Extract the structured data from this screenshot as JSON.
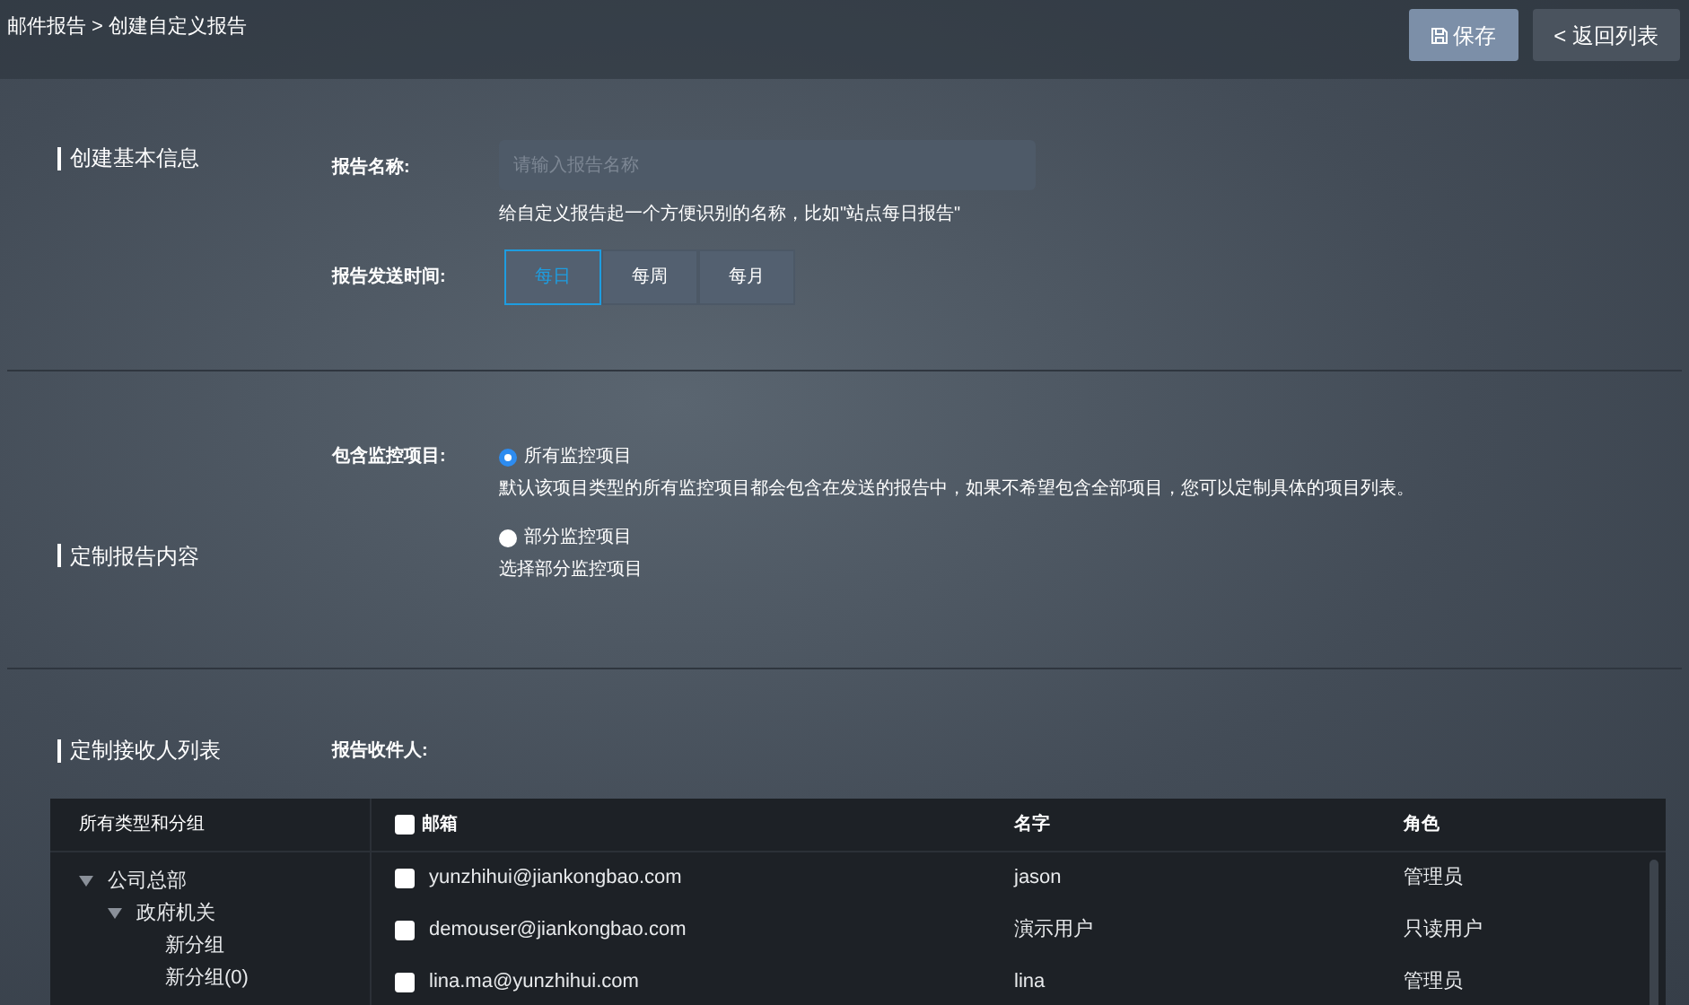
{
  "breadcrumb": "邮件报告 > 创建自定义报告",
  "header_buttons": [
    {
      "kind": "save",
      "label": "保存"
    },
    {
      "kind": "back",
      "label": "< 返回列表"
    }
  ],
  "basic_info": {
    "heading": "创建基本信息",
    "name_label": "报告名称:",
    "name_placeholder": "请输入报告名称",
    "name_help": "给自定义报告起一个方便识别的名称，比如\"站点每日报告\"",
    "time_label": "报告发送时间:",
    "time_options": [
      {
        "label": "每日",
        "selected": true
      },
      {
        "label": "每周",
        "selected": false
      },
      {
        "label": "每月",
        "selected": false
      }
    ]
  },
  "content": {
    "heading": "定制报告内容",
    "label": "包含监控项目:",
    "options": [
      {
        "label": "所有监控项目",
        "description": "默认该项目类型的所有监控项目都会包含在发送的报告中，如果不希望包含全部项目，您可以定制具体的项目列表。",
        "selected": true
      },
      {
        "label": "部分监控项目",
        "description": "选择部分监控项目",
        "selected": false
      }
    ]
  },
  "recipients": {
    "heading": "定制接收人列表",
    "label": "报告收件人:",
    "tree_heading": "所有类型和分组",
    "tree": [
      {
        "label": "公司总部",
        "expanded": true,
        "children": [
          {
            "label": "政府机关",
            "expanded": true,
            "children": [
              {
                "label": "新分组"
              },
              {
                "label": "新分组(0)"
              }
            ]
          }
        ]
      }
    ],
    "table": {
      "columns": [
        "邮箱",
        "名字",
        "角色"
      ],
      "all_checked": false,
      "rows": [
        {
          "email": "yunzhihui@jiankongbao.com",
          "name": "jason",
          "role": "管理员",
          "checked": false
        },
        {
          "email": "demouser@jiankongbao.com",
          "name": "演示用户",
          "role": "只读用户",
          "checked": false
        },
        {
          "email": "lina.ma@yunzhihui.com",
          "name": "lina",
          "role": "管理员",
          "checked": false
        }
      ]
    }
  }
}
